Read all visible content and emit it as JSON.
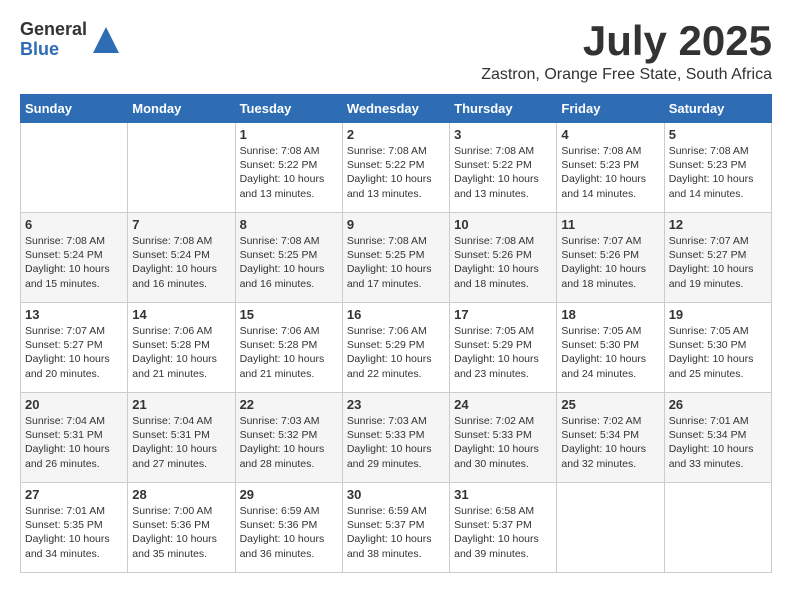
{
  "logo": {
    "general": "General",
    "blue": "Blue"
  },
  "title": "July 2025",
  "subtitle": "Zastron, Orange Free State, South Africa",
  "days_of_week": [
    "Sunday",
    "Monday",
    "Tuesday",
    "Wednesday",
    "Thursday",
    "Friday",
    "Saturday"
  ],
  "weeks": [
    [
      {
        "day": "",
        "info": ""
      },
      {
        "day": "",
        "info": ""
      },
      {
        "day": "1",
        "info": "Sunrise: 7:08 AM\nSunset: 5:22 PM\nDaylight: 10 hours\nand 13 minutes."
      },
      {
        "day": "2",
        "info": "Sunrise: 7:08 AM\nSunset: 5:22 PM\nDaylight: 10 hours\nand 13 minutes."
      },
      {
        "day": "3",
        "info": "Sunrise: 7:08 AM\nSunset: 5:22 PM\nDaylight: 10 hours\nand 13 minutes."
      },
      {
        "day": "4",
        "info": "Sunrise: 7:08 AM\nSunset: 5:23 PM\nDaylight: 10 hours\nand 14 minutes."
      },
      {
        "day": "5",
        "info": "Sunrise: 7:08 AM\nSunset: 5:23 PM\nDaylight: 10 hours\nand 14 minutes."
      }
    ],
    [
      {
        "day": "6",
        "info": "Sunrise: 7:08 AM\nSunset: 5:24 PM\nDaylight: 10 hours\nand 15 minutes."
      },
      {
        "day": "7",
        "info": "Sunrise: 7:08 AM\nSunset: 5:24 PM\nDaylight: 10 hours\nand 16 minutes."
      },
      {
        "day": "8",
        "info": "Sunrise: 7:08 AM\nSunset: 5:25 PM\nDaylight: 10 hours\nand 16 minutes."
      },
      {
        "day": "9",
        "info": "Sunrise: 7:08 AM\nSunset: 5:25 PM\nDaylight: 10 hours\nand 17 minutes."
      },
      {
        "day": "10",
        "info": "Sunrise: 7:08 AM\nSunset: 5:26 PM\nDaylight: 10 hours\nand 18 minutes."
      },
      {
        "day": "11",
        "info": "Sunrise: 7:07 AM\nSunset: 5:26 PM\nDaylight: 10 hours\nand 18 minutes."
      },
      {
        "day": "12",
        "info": "Sunrise: 7:07 AM\nSunset: 5:27 PM\nDaylight: 10 hours\nand 19 minutes."
      }
    ],
    [
      {
        "day": "13",
        "info": "Sunrise: 7:07 AM\nSunset: 5:27 PM\nDaylight: 10 hours\nand 20 minutes."
      },
      {
        "day": "14",
        "info": "Sunrise: 7:06 AM\nSunset: 5:28 PM\nDaylight: 10 hours\nand 21 minutes."
      },
      {
        "day": "15",
        "info": "Sunrise: 7:06 AM\nSunset: 5:28 PM\nDaylight: 10 hours\nand 21 minutes."
      },
      {
        "day": "16",
        "info": "Sunrise: 7:06 AM\nSunset: 5:29 PM\nDaylight: 10 hours\nand 22 minutes."
      },
      {
        "day": "17",
        "info": "Sunrise: 7:05 AM\nSunset: 5:29 PM\nDaylight: 10 hours\nand 23 minutes."
      },
      {
        "day": "18",
        "info": "Sunrise: 7:05 AM\nSunset: 5:30 PM\nDaylight: 10 hours\nand 24 minutes."
      },
      {
        "day": "19",
        "info": "Sunrise: 7:05 AM\nSunset: 5:30 PM\nDaylight: 10 hours\nand 25 minutes."
      }
    ],
    [
      {
        "day": "20",
        "info": "Sunrise: 7:04 AM\nSunset: 5:31 PM\nDaylight: 10 hours\nand 26 minutes."
      },
      {
        "day": "21",
        "info": "Sunrise: 7:04 AM\nSunset: 5:31 PM\nDaylight: 10 hours\nand 27 minutes."
      },
      {
        "day": "22",
        "info": "Sunrise: 7:03 AM\nSunset: 5:32 PM\nDaylight: 10 hours\nand 28 minutes."
      },
      {
        "day": "23",
        "info": "Sunrise: 7:03 AM\nSunset: 5:33 PM\nDaylight: 10 hours\nand 29 minutes."
      },
      {
        "day": "24",
        "info": "Sunrise: 7:02 AM\nSunset: 5:33 PM\nDaylight: 10 hours\nand 30 minutes."
      },
      {
        "day": "25",
        "info": "Sunrise: 7:02 AM\nSunset: 5:34 PM\nDaylight: 10 hours\nand 32 minutes."
      },
      {
        "day": "26",
        "info": "Sunrise: 7:01 AM\nSunset: 5:34 PM\nDaylight: 10 hours\nand 33 minutes."
      }
    ],
    [
      {
        "day": "27",
        "info": "Sunrise: 7:01 AM\nSunset: 5:35 PM\nDaylight: 10 hours\nand 34 minutes."
      },
      {
        "day": "28",
        "info": "Sunrise: 7:00 AM\nSunset: 5:36 PM\nDaylight: 10 hours\nand 35 minutes."
      },
      {
        "day": "29",
        "info": "Sunrise: 6:59 AM\nSunset: 5:36 PM\nDaylight: 10 hours\nand 36 minutes."
      },
      {
        "day": "30",
        "info": "Sunrise: 6:59 AM\nSunset: 5:37 PM\nDaylight: 10 hours\nand 38 minutes."
      },
      {
        "day": "31",
        "info": "Sunrise: 6:58 AM\nSunset: 5:37 PM\nDaylight: 10 hours\nand 39 minutes."
      },
      {
        "day": "",
        "info": ""
      },
      {
        "day": "",
        "info": ""
      }
    ]
  ]
}
